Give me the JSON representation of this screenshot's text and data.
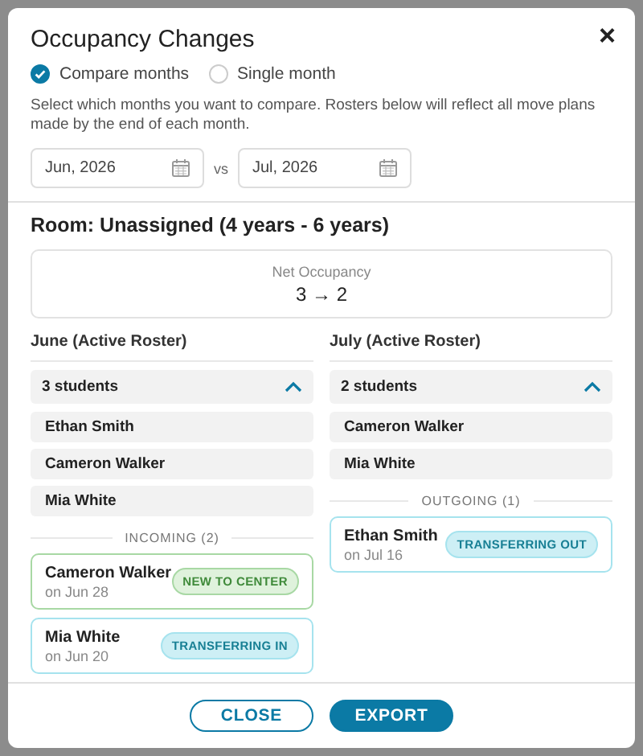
{
  "dialog": {
    "title": "Occupancy Changes",
    "close_label": "×"
  },
  "modes": [
    {
      "label": "Compare months",
      "selected": true
    },
    {
      "label": "Single month",
      "selected": false
    }
  ],
  "description": "Select which months you want to compare. Rosters below will reflect all move plans made by the end of each month.",
  "dates": {
    "from": "Jun, 2026",
    "separator": "vs",
    "to": "Jul, 2026"
  },
  "room_title": "Room: Unassigned (4 years - 6 years)",
  "net_occupancy": {
    "label": "Net Occupancy",
    "value": "3 → 2"
  },
  "columns": [
    {
      "heading": "June (Active Roster)",
      "count": "3 students",
      "expanded": true,
      "students": [
        "Ethan Smith",
        "Cameron Walker",
        "Mia White"
      ],
      "changes_heading": "INCOMING (2)",
      "changes": [
        {
          "name": "Cameron Walker",
          "date": "on Jun 28",
          "badge": "NEW TO CENTER",
          "kind": "new"
        },
        {
          "name": "Mia White",
          "date": "on Jun 20",
          "badge": "TRANSFERRING IN",
          "kind": "transfer"
        }
      ]
    },
    {
      "heading": "July (Active Roster)",
      "count": "2 students",
      "expanded": true,
      "students": [
        "Cameron Walker",
        "Mia White"
      ],
      "changes_heading": "OUTGOING (1)",
      "changes": [
        {
          "name": "Ethan Smith",
          "date": "on Jul 16",
          "badge": "TRANSFERRING OUT",
          "kind": "transfer"
        }
      ]
    }
  ],
  "buttons": {
    "close": "CLOSE",
    "export": "EXPORT"
  }
}
